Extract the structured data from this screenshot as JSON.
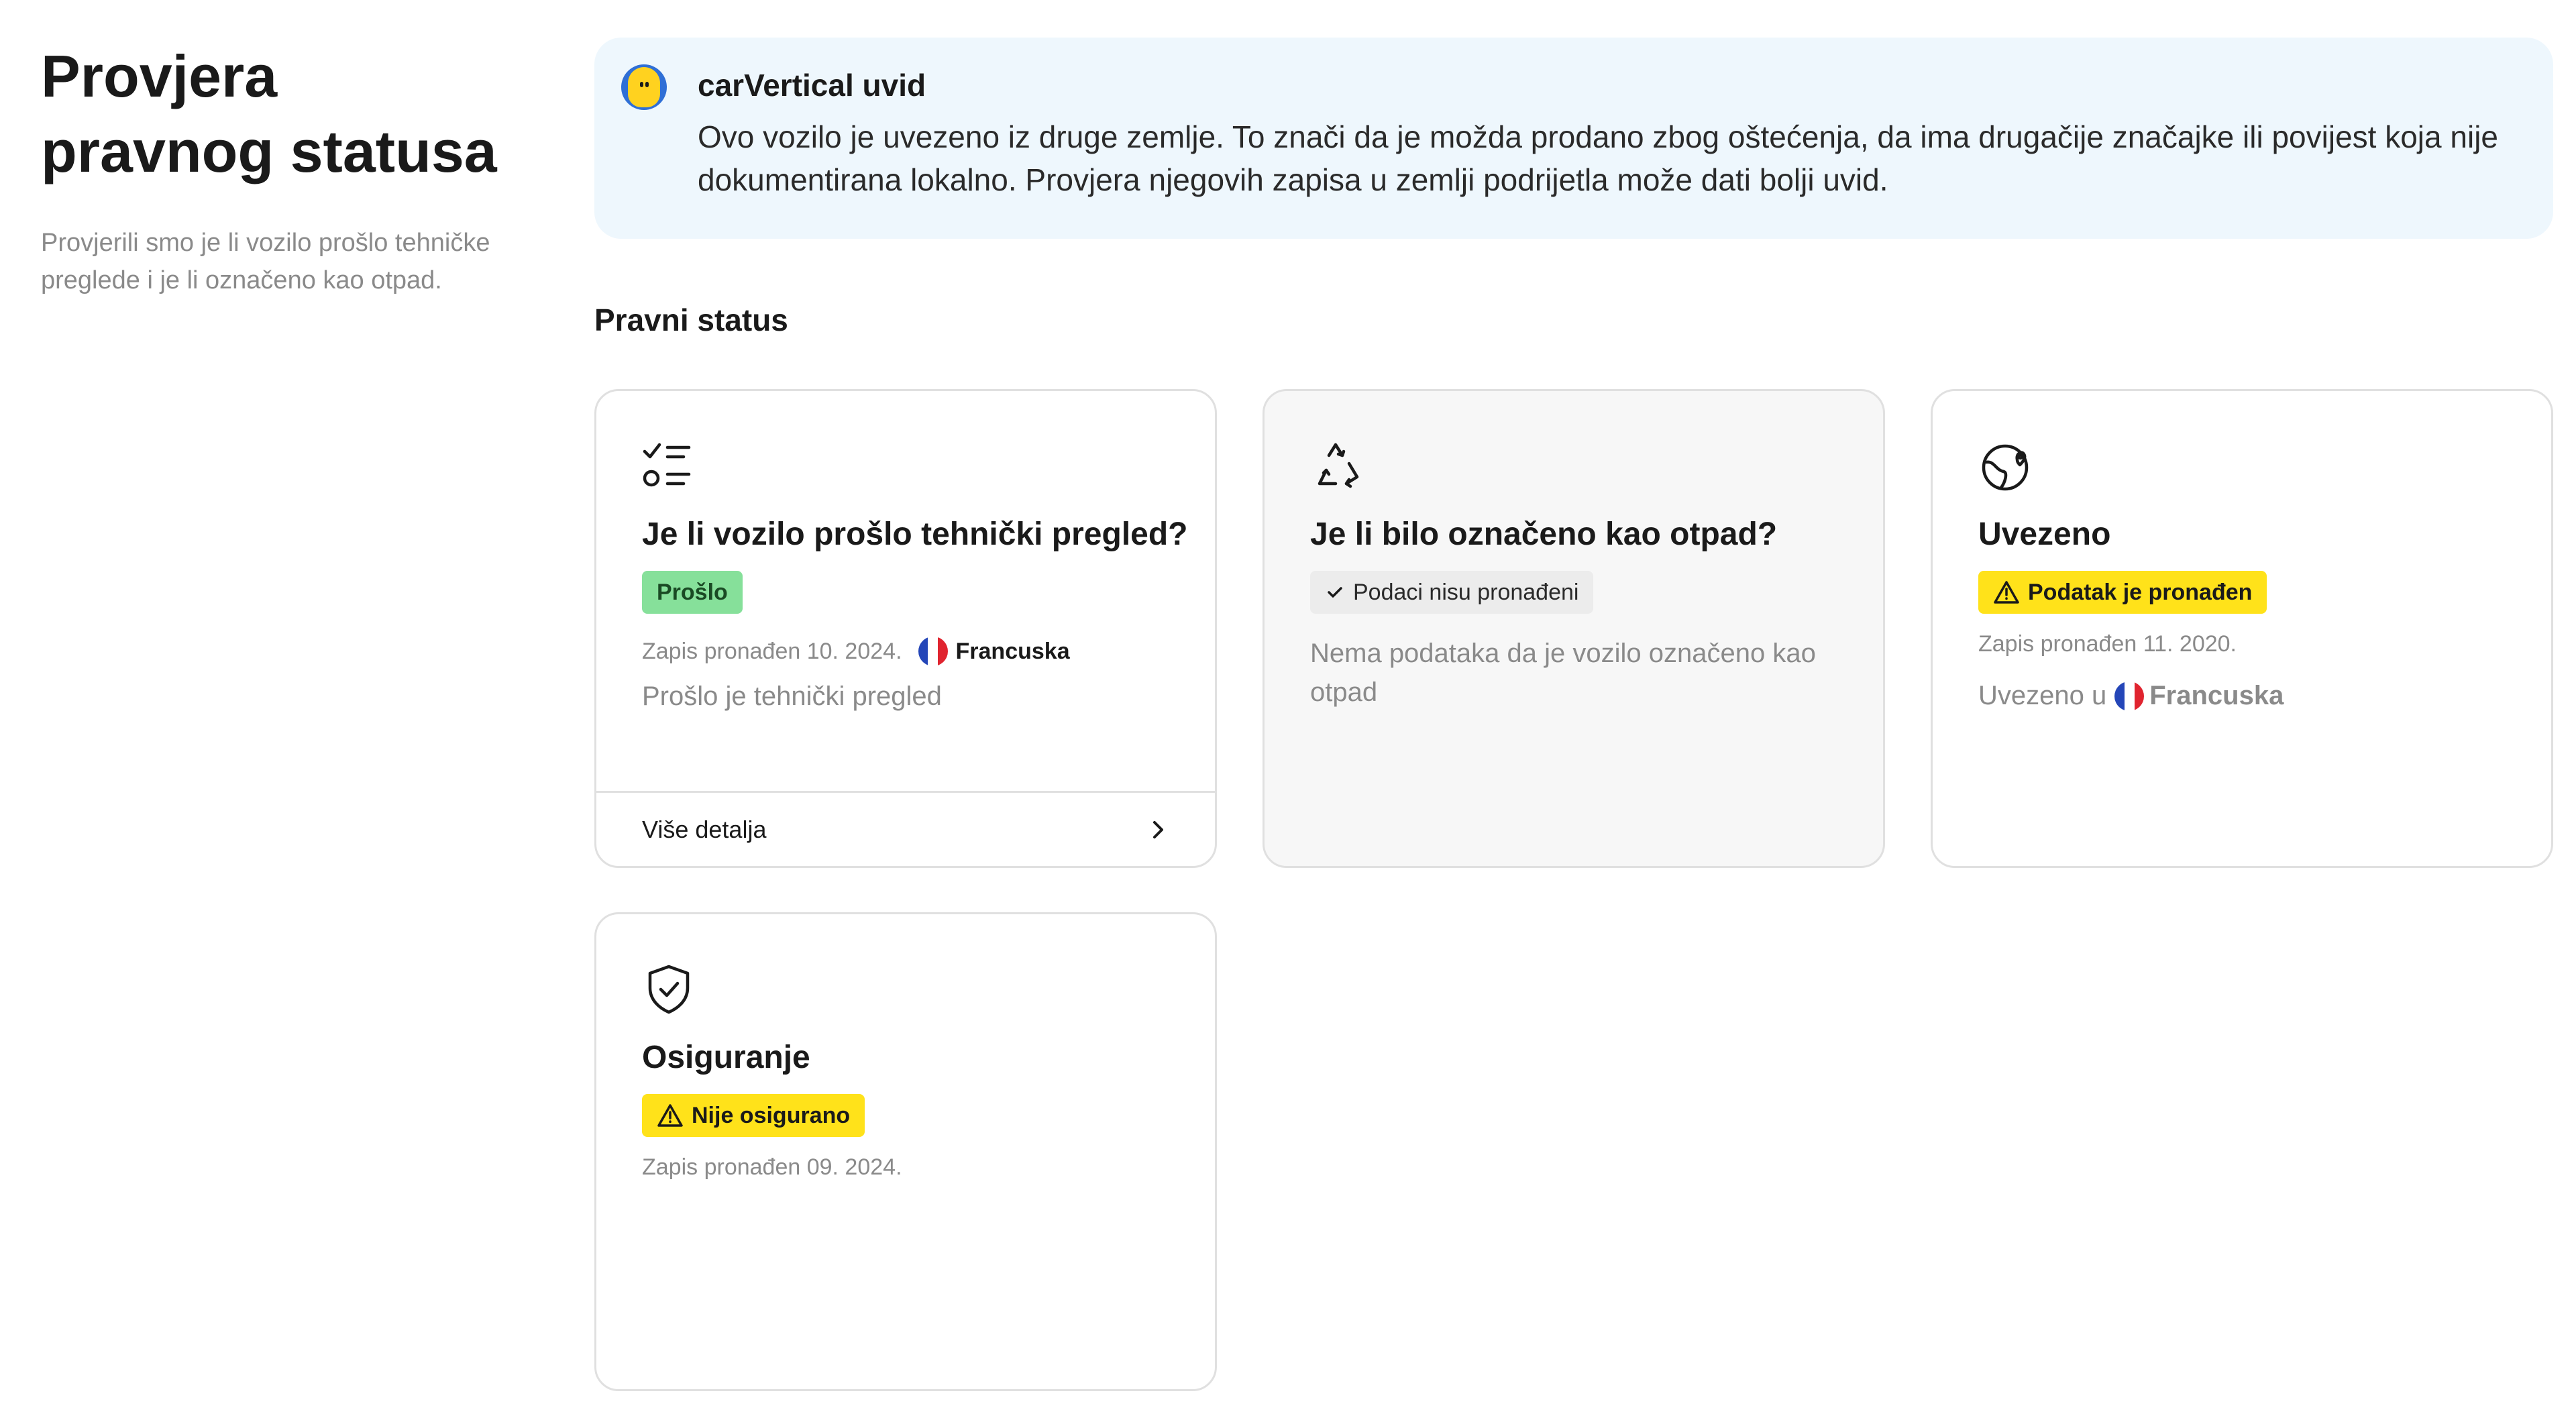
{
  "left": {
    "title_line1": "Provjera",
    "title_line2": "pravnog statusa",
    "description": "Provjerili smo je li vozilo prošlo tehničke preglede i je li označeno kao otpad."
  },
  "insight": {
    "logo_icon": "carvertical-logo",
    "title": "carVertical uvid",
    "text": "Ovo vozilo je uvezeno iz druge zemlje. To znači da je možda prodano zbog oštećenja, da ima drugačije značajke ili povijest koja nije dokumentirana lokalno. Provjera njegovih zapisa u zemlji podrijetla može dati bolji uvid."
  },
  "section_title": "Pravni status",
  "cards": {
    "inspection": {
      "icon": "checklist-icon",
      "title": "Je li vozilo prošlo tehnički pregled?",
      "badge": "Prošlo",
      "record": "Zapis pronađen 10. 2024.",
      "country": "Francuska",
      "note": "Prošlo je tehnički pregled",
      "footer": "Više detalja"
    },
    "scrap": {
      "icon": "recycle-icon",
      "title": "Je li bilo označeno kao otpad?",
      "badge": "Podaci nisu pronađeni",
      "note": "Nema podataka da je vozilo označeno kao otpad"
    },
    "imported": {
      "icon": "globe-pin-icon",
      "title": "Uvezeno",
      "badge": "Podatak je pronađen",
      "record": "Zapis pronađen 11. 2020.",
      "note_prefix": "Uvezeno u",
      "country": "Francuska"
    },
    "insurance": {
      "icon": "shield-check-icon",
      "title": "Osiguranje",
      "badge": "Nije osigurano",
      "record": "Zapis pronađen 09. 2024."
    }
  },
  "colors": {
    "insight_bg": "#eef7fd",
    "badge_green": "#86e09a",
    "badge_yellow": "#ffe21a",
    "badge_grey": "#ececec",
    "flag_blue": "#2446b8",
    "flag_red": "#e0242f"
  }
}
